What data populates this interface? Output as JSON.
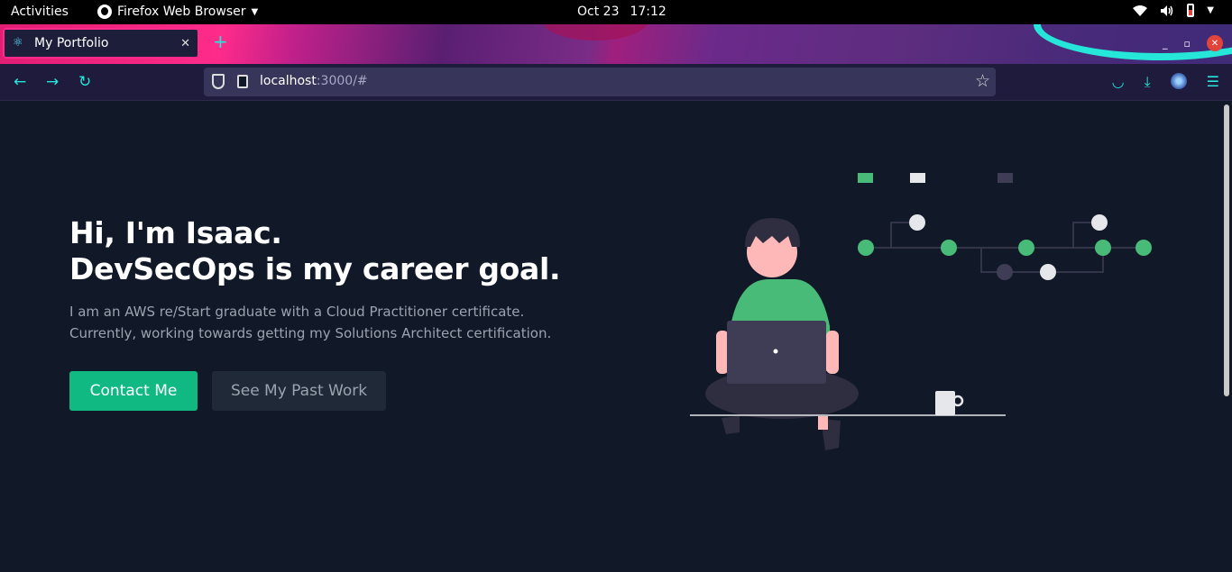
{
  "system": {
    "activities": "Activities",
    "app_name": "Firefox Web Browser",
    "date": "Oct 23",
    "time": "17:12"
  },
  "browser": {
    "tab_title": "My Portfolio",
    "url_host": "localhost",
    "url_path": ":3000/#"
  },
  "hero": {
    "title_line1": "Hi, I'm Isaac.",
    "title_line2": "DevSecOps is my career goal.",
    "desc_line1": "I am an AWS re/Start graduate with a Cloud Practitioner certificate.",
    "desc_line2": "Currently, working towards getting my Solutions Architect certification.",
    "primary_button": "Contact Me",
    "secondary_button": "See My Past Work"
  },
  "colors": {
    "accent_green": "#10b981",
    "page_background": "#111827",
    "browser_accent": "#26e6d9"
  }
}
